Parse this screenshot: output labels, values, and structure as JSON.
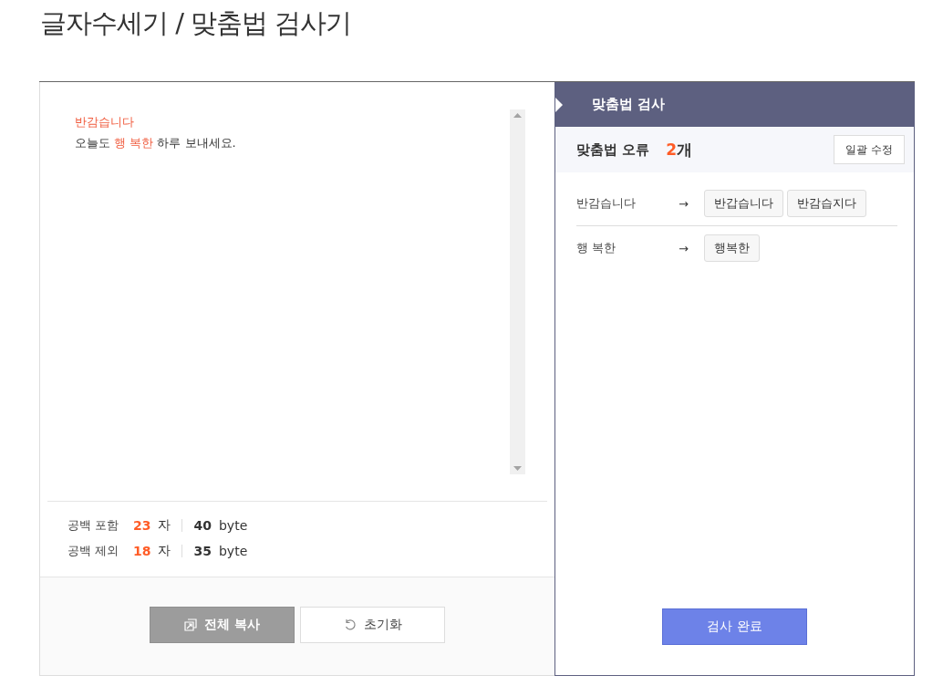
{
  "title": "글자수세기 / 맞춤법 검사기",
  "editor": {
    "lines": [
      [
        {
          "text": "반감습니다",
          "error": true
        }
      ],
      [
        {
          "text": "오늘도 ",
          "error": false
        },
        {
          "text": "행 복한",
          "error": true
        },
        {
          "text": " 하루 보내세요.",
          "error": false
        }
      ]
    ]
  },
  "stats": [
    {
      "label": "공백 포함",
      "count": "23",
      "unit": "자",
      "bytes": "40",
      "byte_unit": "byte"
    },
    {
      "label": "공백 제외",
      "count": "18",
      "unit": "자",
      "bytes": "35",
      "byte_unit": "byte"
    }
  ],
  "actions": [
    {
      "label": "전체 복사",
      "kind": "copy"
    },
    {
      "label": "초기화",
      "kind": "reset"
    }
  ],
  "panel": {
    "title": "맞춤법 검사",
    "error_label": "맞춤법 오류",
    "error_count": "2",
    "error_unit": "개",
    "fix_all": "일괄 수정",
    "corrections": [
      {
        "original": "반감습니다",
        "arrow": "→",
        "suggestions": [
          "반갑습니다",
          "반감습지다"
        ]
      },
      {
        "original": "행 복한",
        "arrow": "→",
        "suggestions": [
          "행복한"
        ]
      }
    ],
    "done": "검사 완료"
  }
}
